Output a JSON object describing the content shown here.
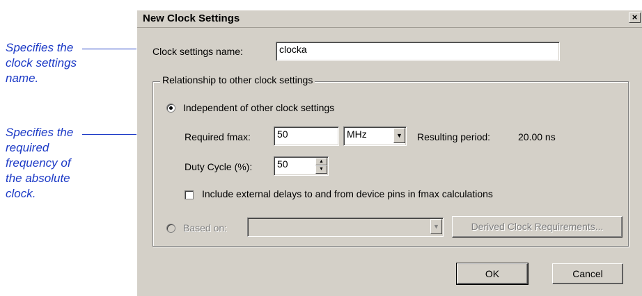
{
  "annotations": {
    "name_note": [
      "Specifies the",
      "clock settings",
      "name."
    ],
    "fmax_note": [
      "Specifies the",
      "required",
      "frequency of",
      "the absolute",
      "clock."
    ]
  },
  "dialog": {
    "title": "New Clock Settings",
    "close_glyph": "×",
    "clock_name_label": "Clock settings name:",
    "clock_name_value": "clocka",
    "group_label": "Relationship to other clock settings",
    "independent_label": "Independent of other clock settings",
    "independent_selected": true,
    "fmax_label": "Required fmax:",
    "fmax_value": "50",
    "fmax_unit": "MHz",
    "resulting_period_label": "Resulting period:",
    "resulting_period_value": "20.00 ns",
    "duty_cycle_label": "Duty Cycle (%):",
    "duty_cycle_value": "50",
    "include_delays_label": "Include external delays to and from device pins in fmax calculations",
    "include_delays_checked": false,
    "based_on_label": "Based on:",
    "based_on_value": "",
    "derived_button": "Derived Clock Requirements...",
    "ok_button": "OK",
    "cancel_button": "Cancel"
  },
  "colors": {
    "annotation": "#1b39c6",
    "dialog_bg": "#d4d0c8"
  }
}
